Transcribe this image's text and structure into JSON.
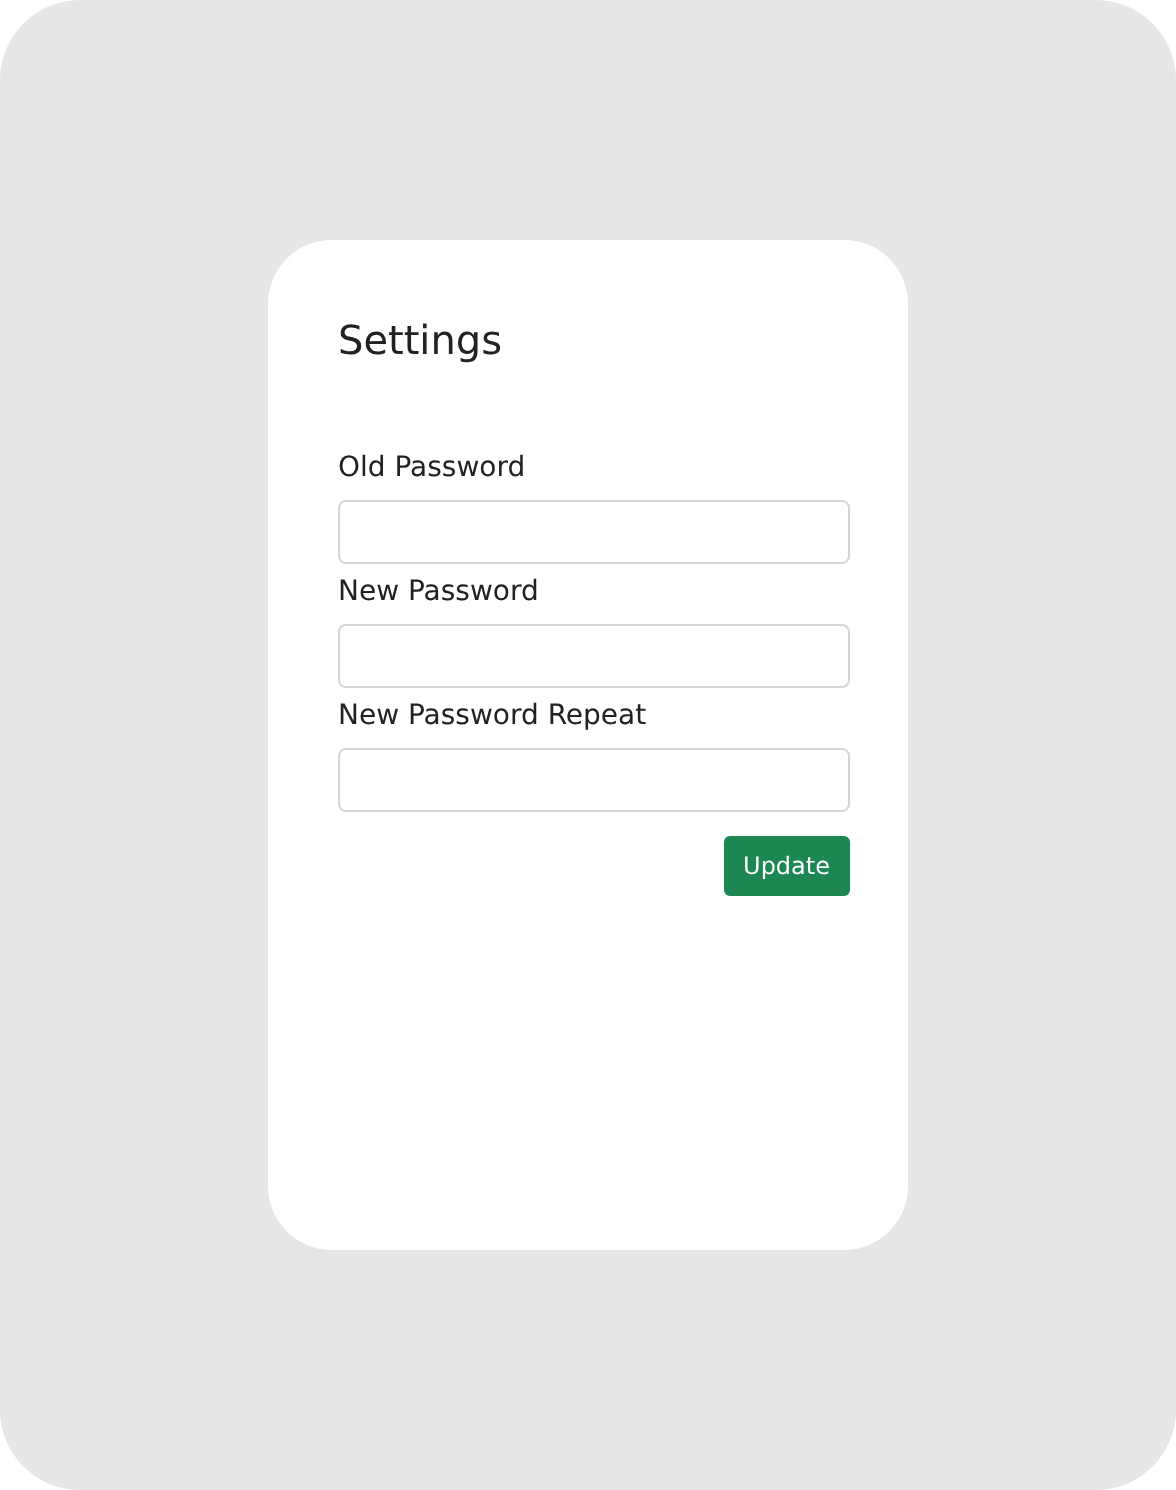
{
  "title": "Settings",
  "fields": [
    {
      "label": "Old Password"
    },
    {
      "label": "New Password"
    },
    {
      "label": "New Password Repeat"
    }
  ],
  "button": "Update"
}
